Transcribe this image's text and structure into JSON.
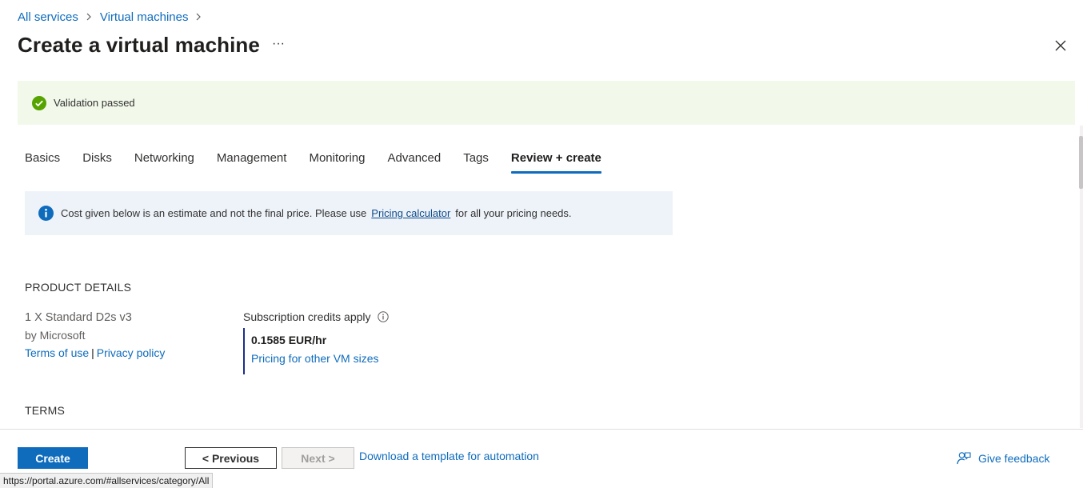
{
  "breadcrumb": {
    "items": [
      {
        "label": "All services"
      },
      {
        "label": "Virtual machines"
      }
    ]
  },
  "page": {
    "title": "Create a virtual machine",
    "more_label": "···"
  },
  "validation": {
    "message": "Validation passed",
    "status_color": "#57a300"
  },
  "tabs": [
    {
      "label": "Basics"
    },
    {
      "label": "Disks"
    },
    {
      "label": "Networking"
    },
    {
      "label": "Management"
    },
    {
      "label": "Monitoring"
    },
    {
      "label": "Advanced"
    },
    {
      "label": "Tags"
    },
    {
      "label": "Review + create",
      "active": true
    }
  ],
  "info": {
    "text_before": "Cost given below is an estimate and not the final price. Please use",
    "link": "Pricing calculator",
    "text_after": "for all your pricing needs."
  },
  "product_details": {
    "heading": "PRODUCT DETAILS",
    "name": "1 X Standard D2s v3",
    "publisher": "by Microsoft",
    "terms_link": "Terms of use",
    "separator": "|",
    "privacy_link": "Privacy policy",
    "credits_label": "Subscription credits apply",
    "price": "0.1585 EUR/hr",
    "pricing_link": "Pricing for other VM sizes"
  },
  "terms": {
    "heading": "TERMS"
  },
  "footer": {
    "create_label": "Create",
    "previous_label": "< Previous",
    "next_label": "Next >",
    "download_label": "Download a template for automation",
    "feedback_label": "Give feedback"
  },
  "status_bar": {
    "url": "https://portal.azure.com/#allservices/category/All"
  },
  "colors": {
    "accent": "#0f6cbd",
    "success_bg": "#f2f9eb",
    "info_bg": "#eef3fa"
  }
}
